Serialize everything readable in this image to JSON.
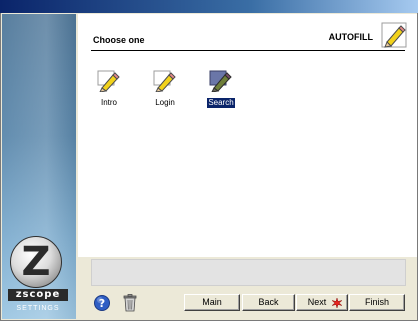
{
  "content": {
    "title": "Choose one",
    "section_label": "AUTOFILL",
    "section_icon": "pencil-icon",
    "items": [
      {
        "label": "Intro",
        "icon": "pencil-icon",
        "selected": false
      },
      {
        "label": "Login",
        "icon": "pencil-icon",
        "selected": false
      },
      {
        "label": "Search",
        "icon": "pencil-selected-icon",
        "selected": true
      }
    ]
  },
  "brand": {
    "logo_letter": "Z",
    "logo_wordmark": "zscope",
    "logo_caption": "SETTINGS"
  },
  "footer": {
    "help_icon": "help-icon",
    "trash_icon": "trash-icon",
    "buttons": {
      "main": "Main",
      "back": "Back",
      "next": "Next",
      "finish": "Finish"
    }
  },
  "colors": {
    "title_strip": "#0a246a",
    "sidebar_top": "#4f7799",
    "sidebar_bottom": "#9cc6e2",
    "selection": "#0a246a",
    "window_bg": "#ece9d8",
    "next_flag": "#e8231f"
  }
}
